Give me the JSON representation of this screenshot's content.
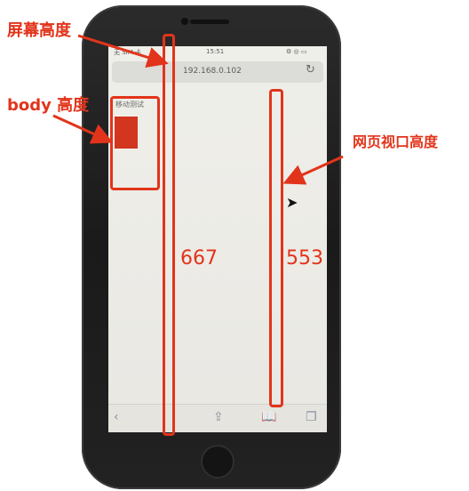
{
  "phone": {
    "status_bar": {
      "carrier": "无 SIM 卡",
      "time": "15:51",
      "right": "⚙ ◎ ▭"
    },
    "address_bar": {
      "url": "192.168.0.102",
      "reload_icon": "reload-icon"
    },
    "page": {
      "heading": "移动测试"
    },
    "toolbar": {
      "icons": [
        "back-icon",
        "share-icon",
        "bookmarks-icon",
        "tabs-icon"
      ]
    }
  },
  "annotations": {
    "screen_height_label": "屏幕高度",
    "body_height_label": "body 高度",
    "viewport_height_label": "网页视口高度",
    "screen_height_value": "667",
    "viewport_height_value": "553",
    "color": "#e2341b"
  }
}
